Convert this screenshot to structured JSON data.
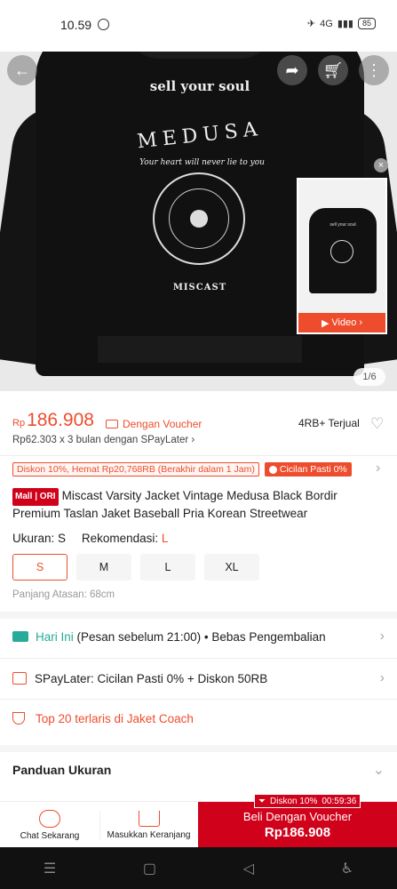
{
  "status_bar": {
    "time": "10.59",
    "signal": "4G",
    "battery": "85"
  },
  "hero": {
    "print_line1": "sell your soul",
    "print_line2": "MEDUSA",
    "print_line3": "Your heart will never lie to you",
    "print_line4": "MISCAST",
    "video_label": "Video",
    "counter": "1/6"
  },
  "price": {
    "currency": "Rp",
    "value": "186.908",
    "voucher_label": "Dengan Voucher",
    "sold": "4RB+ Terjual",
    "spaylater": "Rp62.303 x 3 bulan dengan SPayLater"
  },
  "promo": {
    "discount_tag": "Diskon 10%, Hemat Rp20,768RB (Berakhir dalam 1 Jam)",
    "cicilan_tag": "Cicilan Pasti 0%"
  },
  "product": {
    "badge": "Mall | ORI",
    "title": "Miscast Varsity Jacket Vintage Medusa Black Bordir Premium Taslan Jaket Baseball Pria Korean Streetwear"
  },
  "size": {
    "label": "Ukuran:",
    "selected": "S",
    "rec_label": "Rekomendasi:",
    "rec_value": "L",
    "options": [
      "S",
      "M",
      "L",
      "XL"
    ],
    "length_note": "Panjang Atasan: 68cm"
  },
  "shipping": {
    "today": "Hari Ini",
    "rest": "(Pesan sebelum 21:00) • Bebas Pengembalian"
  },
  "spaylater_row": "SPayLater: Cicilan Pasti 0% + Diskon 50RB",
  "top20": "Top 20 terlaris di Jaket Coach",
  "size_guide": "Panduan Ukuran",
  "bottom": {
    "chat": "Chat Sekarang",
    "cart": "Masukkan Keranjang",
    "buy_line1": "Beli Dengan Voucher",
    "buy_line2": "Rp186.908",
    "timer_discount": "Diskon 10%",
    "timer_time": "00:59:36"
  },
  "colors": {
    "accent": "#ee4d2d",
    "mall": "#d0011b",
    "green": "#26aa99"
  }
}
